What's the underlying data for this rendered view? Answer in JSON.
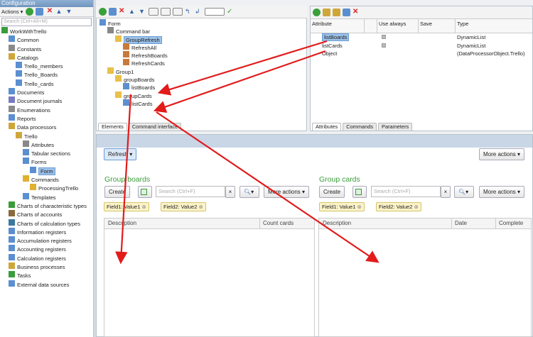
{
  "config": {
    "title": "Configuration",
    "actions_label": "Actions ▾",
    "search_placeholder": "Search (Ctrl+Alt+M)",
    "tree": [
      {
        "label": "WorkWithTrello",
        "icon": "config-icon",
        "indent": 0
      },
      {
        "label": "Common",
        "icon": "common-icon",
        "indent": 1
      },
      {
        "label": "Constants",
        "icon": "constants-icon",
        "indent": 1
      },
      {
        "label": "Catalogs",
        "icon": "catalogs-icon",
        "indent": 1
      },
      {
        "label": "Trello_members",
        "icon": "table-icon",
        "indent": 2
      },
      {
        "label": "Trello_Boards",
        "icon": "table-icon",
        "indent": 2
      },
      {
        "label": "Trello_cards",
        "icon": "table-icon",
        "indent": 2
      },
      {
        "label": "Documents",
        "icon": "documents-icon",
        "indent": 1
      },
      {
        "label": "Document journals",
        "icon": "journal-icon",
        "indent": 1
      },
      {
        "label": "Enumerations",
        "icon": "enum-icon",
        "indent": 1
      },
      {
        "label": "Reports",
        "icon": "report-icon",
        "indent": 1
      },
      {
        "label": "Data processors",
        "icon": "processor-icon",
        "indent": 1
      },
      {
        "label": "Trello",
        "icon": "processor-icon",
        "indent": 2
      },
      {
        "label": "Attributes",
        "icon": "attributes-icon",
        "indent": 3
      },
      {
        "label": "Tabular sections",
        "icon": "tabular-icon",
        "indent": 3
      },
      {
        "label": "Forms",
        "icon": "forms-icon",
        "indent": 3
      },
      {
        "label": "Form",
        "icon": "form-icon",
        "indent": 4,
        "selected": true
      },
      {
        "label": "Commands",
        "icon": "commands-icon",
        "indent": 3
      },
      {
        "label": "ProcessingTrello",
        "icon": "command-icon",
        "indent": 4
      },
      {
        "label": "Templates",
        "icon": "templates-icon",
        "indent": 3
      },
      {
        "label": "Charts of characteristic types",
        "icon": "chart-icon",
        "indent": 1
      },
      {
        "label": "Charts of accounts",
        "icon": "accounts-icon",
        "indent": 1
      },
      {
        "label": "Charts of calculation types",
        "icon": "calc-icon",
        "indent": 1
      },
      {
        "label": "Information registers",
        "icon": "register-icon",
        "indent": 1
      },
      {
        "label": "Accumulation registers",
        "icon": "register-icon",
        "indent": 1
      },
      {
        "label": "Accounting registers",
        "icon": "register-icon",
        "indent": 1
      },
      {
        "label": "Calculation registers",
        "icon": "register-icon",
        "indent": 1
      },
      {
        "label": "Business processes",
        "icon": "process-icon",
        "indent": 1
      },
      {
        "label": "Tasks",
        "icon": "task-icon",
        "indent": 1
      },
      {
        "label": "External data sources",
        "icon": "datasource-icon",
        "indent": 1
      }
    ]
  },
  "form_tree": [
    {
      "label": "Form",
      "indent": 0,
      "icon": "form-icon"
    },
    {
      "label": "Command bar",
      "indent": 1,
      "icon": "commandbar-icon"
    },
    {
      "label": "GroupRefresh",
      "indent": 2,
      "icon": "folder-icon",
      "selected": true
    },
    {
      "label": "RefreshAll",
      "indent": 3,
      "icon": "button-icon"
    },
    {
      "label": "RefreshBoards",
      "indent": 3,
      "icon": "button-icon"
    },
    {
      "label": "RefreshCards",
      "indent": 3,
      "icon": "button-icon"
    },
    {
      "label": "Group1",
      "indent": 1,
      "icon": "folder-icon"
    },
    {
      "label": "groupBoards",
      "indent": 2,
      "icon": "folder-icon"
    },
    {
      "label": "listBoards",
      "indent": 3,
      "icon": "table-icon"
    },
    {
      "label": "groupCards",
      "indent": 2,
      "icon": "folder-icon"
    },
    {
      "label": "listCards",
      "indent": 3,
      "icon": "table-icon"
    }
  ],
  "form_tabs": [
    "Elements",
    "Command interface"
  ],
  "attr_headers": [
    "Attribute",
    "Use always",
    "Save",
    "Type"
  ],
  "attr_rows": [
    {
      "name": "listBoards",
      "type": "DynamicList",
      "selected": true
    },
    {
      "name": "listCards",
      "type": "DynamicList"
    },
    {
      "name": "Object",
      "type": "(DataProcessorObject.Trello)"
    }
  ],
  "attr_tabs": [
    "Attributes",
    "Commands",
    "Parameters"
  ],
  "preview": {
    "refresh": "Refresh",
    "more_actions": "More actions",
    "boards": {
      "title": "Group boards",
      "create": "Create",
      "search": "Search (Ctrl+F)",
      "chips": [
        "Field1: Value1",
        "Field2: Value2"
      ],
      "cols": [
        "Description",
        "Count cards"
      ]
    },
    "cards": {
      "title": "Group cards",
      "create": "Create",
      "search": "Search (Ctrl+F)",
      "chips": [
        "Field1: Value1",
        "Field2: Value2"
      ],
      "cols": [
        "Description",
        "Date",
        "Complete"
      ]
    }
  },
  "colors": {
    "arrow": "#e21b1b",
    "group_title": "#3a9c3a"
  }
}
